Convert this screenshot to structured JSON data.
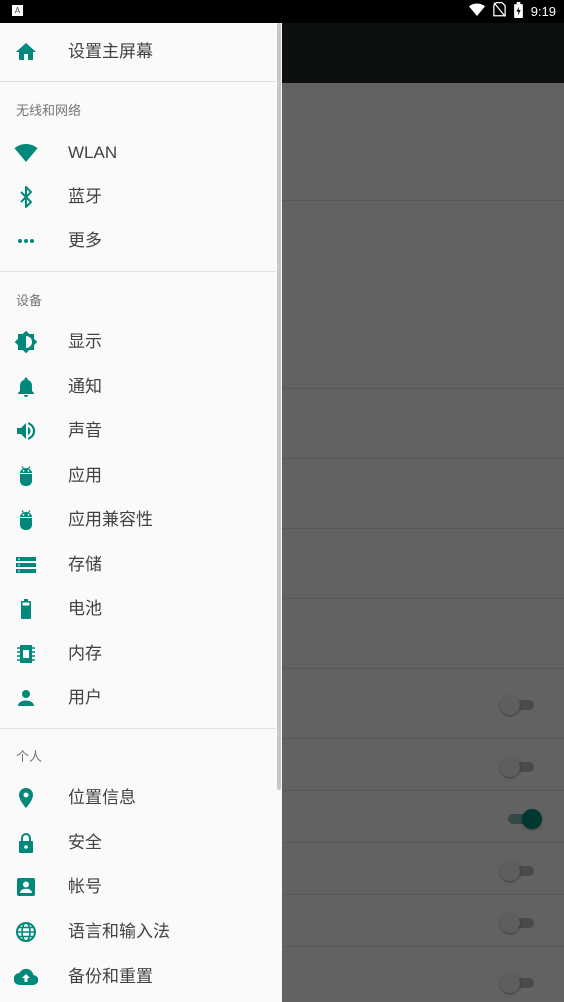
{
  "status_bar": {
    "left_icon_letter": "A",
    "time": "9:19",
    "icons": [
      "wifi-icon",
      "no-sim-icon",
      "battery-charging-icon"
    ]
  },
  "accent_color": "#00897b",
  "drawer": {
    "home": {
      "label": "设置主屏幕",
      "icon": "home-icon"
    },
    "sections": [
      {
        "title": "无线和网络",
        "items": [
          {
            "label": "WLAN",
            "icon": "wifi-icon"
          },
          {
            "label": "蓝牙",
            "icon": "bluetooth-icon"
          },
          {
            "label": "更多",
            "icon": "more-horiz-icon"
          }
        ]
      },
      {
        "title": "设备",
        "items": [
          {
            "label": "显示",
            "icon": "brightness-icon"
          },
          {
            "label": "通知",
            "icon": "bell-icon"
          },
          {
            "label": "声音",
            "icon": "volume-icon"
          },
          {
            "label": "应用",
            "icon": "android-icon"
          },
          {
            "label": "应用兼容性",
            "icon": "android-icon"
          },
          {
            "label": "存储",
            "icon": "storage-icon"
          },
          {
            "label": "电池",
            "icon": "battery-icon"
          },
          {
            "label": "内存",
            "icon": "memory-chip-icon"
          },
          {
            "label": "用户",
            "icon": "person-icon"
          }
        ]
      },
      {
        "title": "个人",
        "items": [
          {
            "label": "位置信息",
            "icon": "location-pin-icon"
          },
          {
            "label": "安全",
            "icon": "lock-icon"
          },
          {
            "label": "帐号",
            "icon": "account-box-icon"
          },
          {
            "label": "语言和输入法",
            "icon": "globe-icon"
          },
          {
            "label": "备份和重置",
            "icon": "cloud-upload-icon"
          }
        ]
      }
    ]
  },
  "background": {
    "switch_states": [
      false,
      false,
      true,
      false,
      false,
      false
    ]
  }
}
